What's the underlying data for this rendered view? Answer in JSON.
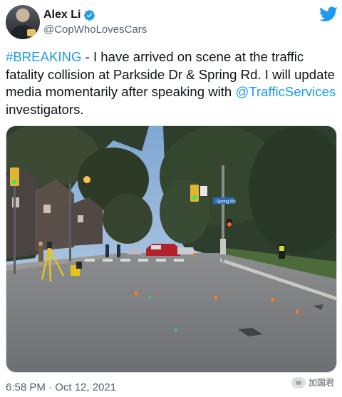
{
  "author": {
    "display_name": "Alex Li",
    "handle": "@CopWhoLovesCars",
    "verified": true,
    "avatar_icon": "profile-photo"
  },
  "brand": {
    "icon": "twitter-bird-icon",
    "color": "#1d9bf0"
  },
  "tweet": {
    "hashtag": "#BREAKING",
    "text_part1": " - I have arrived on scene at the traffic fatality collision at Parkside Dr & Spring Rd. I will update media momentarily after speaking with ",
    "mention": "@TrafficServices",
    "text_part2": " investigators."
  },
  "photo": {
    "street_sign": "Spring Rd"
  },
  "meta": {
    "timestamp": "6:58 PM · Oct 12, 2021"
  },
  "watermark": {
    "text": "加国君"
  },
  "colors": {
    "link": "#1d9bf0",
    "secondary": "#536471",
    "text": "#0f1419"
  }
}
